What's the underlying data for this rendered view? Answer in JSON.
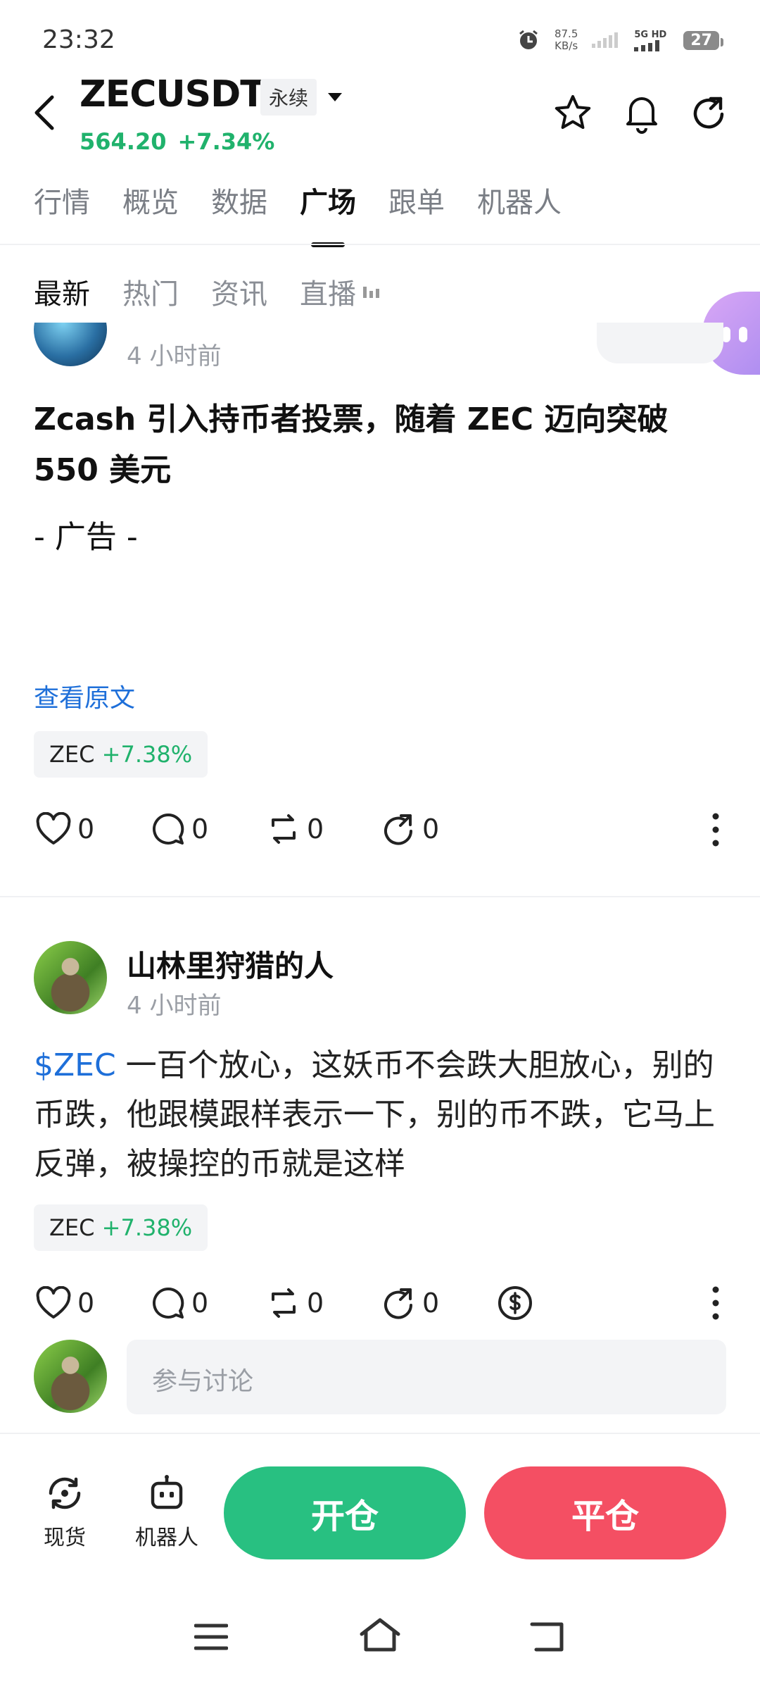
{
  "status_bar": {
    "time": "23:32",
    "net_speed_value": "87.5",
    "net_speed_unit": "KB/s",
    "signal_label": "5G HD",
    "battery": "27"
  },
  "header": {
    "pair": "ZECUSDT",
    "contract_type": "永续",
    "price": "564.20",
    "change": "+7.34%"
  },
  "main_tabs": [
    "行情",
    "概览",
    "数据",
    "广场",
    "跟单",
    "机器人"
  ],
  "sub_tabs": [
    "最新",
    "热门",
    "资讯",
    "直播"
  ],
  "post1": {
    "time": "4 小时前",
    "title": "Zcash 引入持币者投票，随着 ZEC 迈向突破 550 美元",
    "ad": "- 广告 -",
    "view_original": "查看原文",
    "tag_symbol": "ZEC",
    "tag_change": "+7.38%",
    "likes": "0",
    "comments": "0",
    "reposts": "0",
    "shares": "0"
  },
  "post2": {
    "user": "山林里狩猎的人",
    "time": "4 小时前",
    "cashtag": "$ZEC",
    "body": " 一百个放心，这妖币不会跌大胆放心，别的币跌，他跟模跟样表示一下，别的币不跌，它马上反弹，被操控的币就是这样",
    "tag_symbol": "ZEC",
    "tag_change": "+7.38%",
    "likes": "0",
    "comments": "0",
    "reposts": "0",
    "shares": "0"
  },
  "comment": {
    "placeholder": "参与讨论"
  },
  "bottom_bar": {
    "spot": "现货",
    "bot": "机器人",
    "open": "开仓",
    "close": "平仓"
  },
  "colors": {
    "green": "#20b26c",
    "red": "#f44f63",
    "blue": "#1e6fd9"
  }
}
